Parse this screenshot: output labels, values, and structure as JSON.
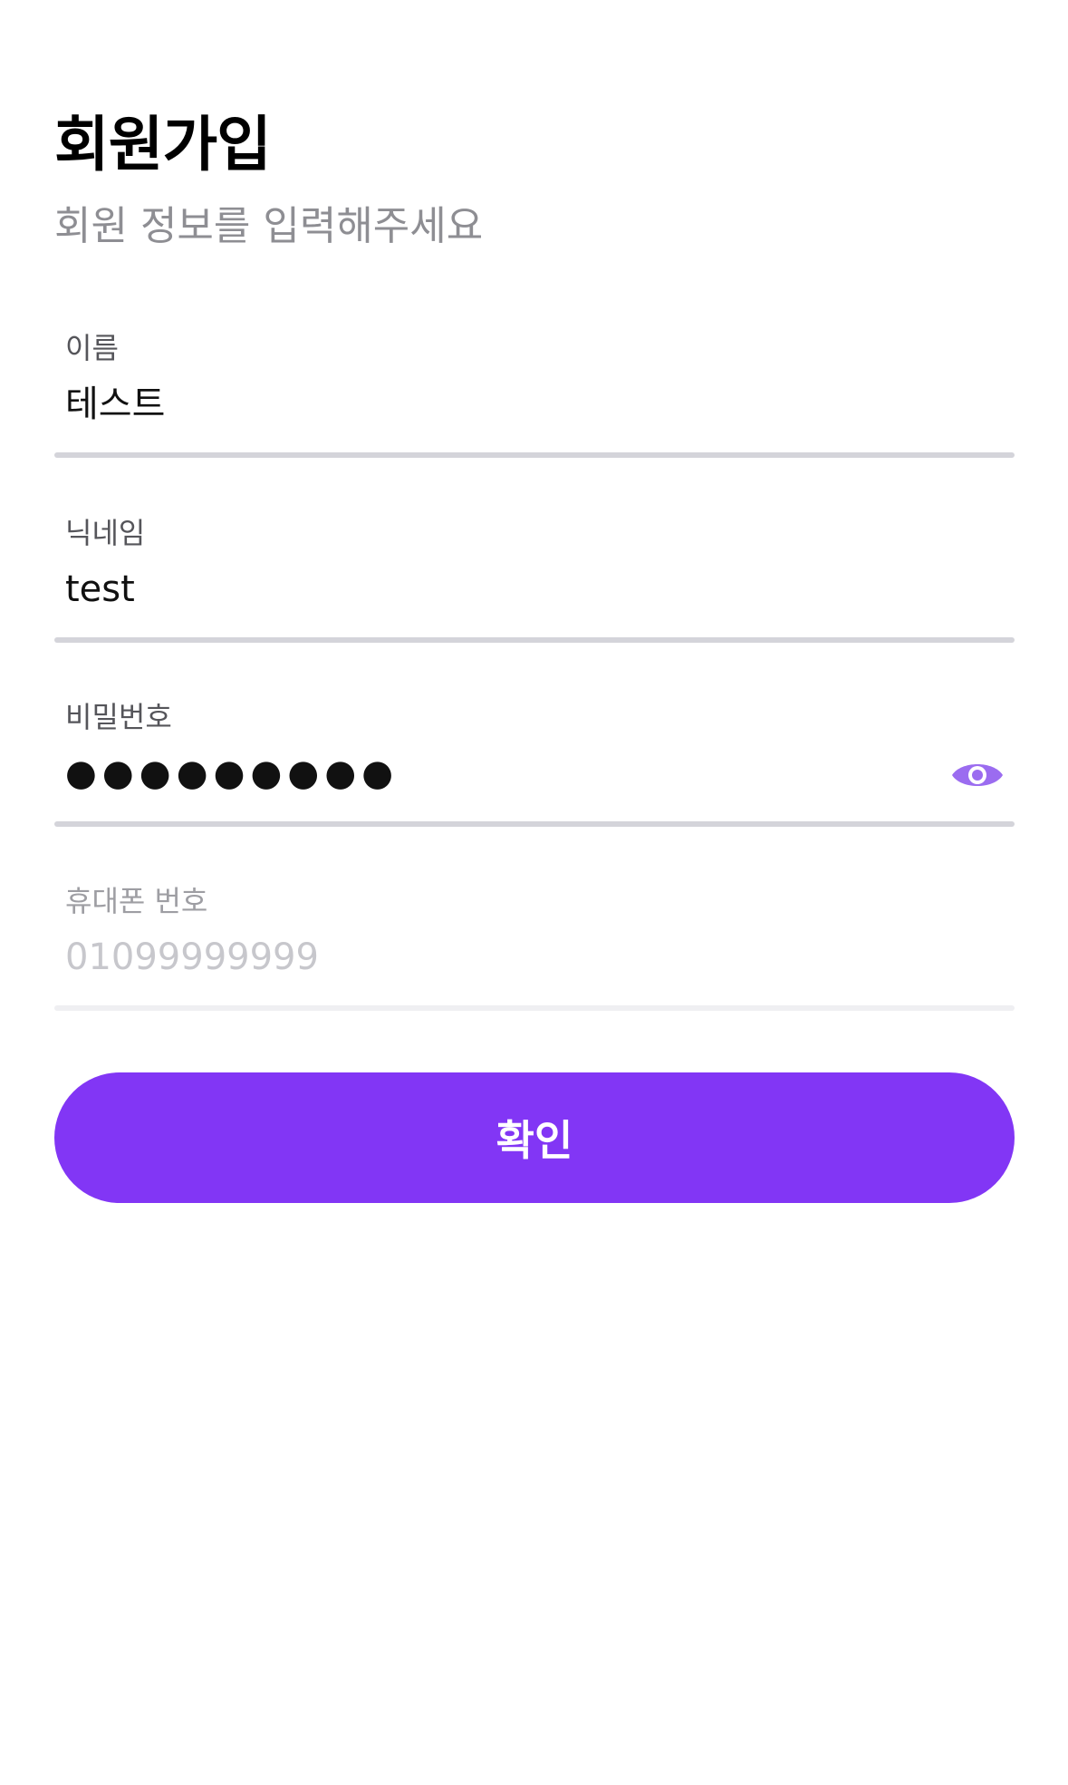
{
  "header": {
    "title": "회원가입",
    "subtitle": "회원 정보를 입력해주세요"
  },
  "form": {
    "name": {
      "label": "이름",
      "value": "테스트",
      "placeholder": ""
    },
    "nickname": {
      "label": "닉네임",
      "value": "test",
      "placeholder": ""
    },
    "password": {
      "label": "비밀번호",
      "value": "●●●●●●●●●",
      "icon": "eye-icon"
    },
    "phone": {
      "label": "휴대폰 번호",
      "value": "",
      "placeholder": "01099999999"
    }
  },
  "actions": {
    "confirm_label": "확인"
  },
  "colors": {
    "accent": "#8236f5",
    "eye_icon": "#9b6cf0",
    "subtitle": "#8e8e93",
    "placeholder": "#c7c7cc"
  }
}
